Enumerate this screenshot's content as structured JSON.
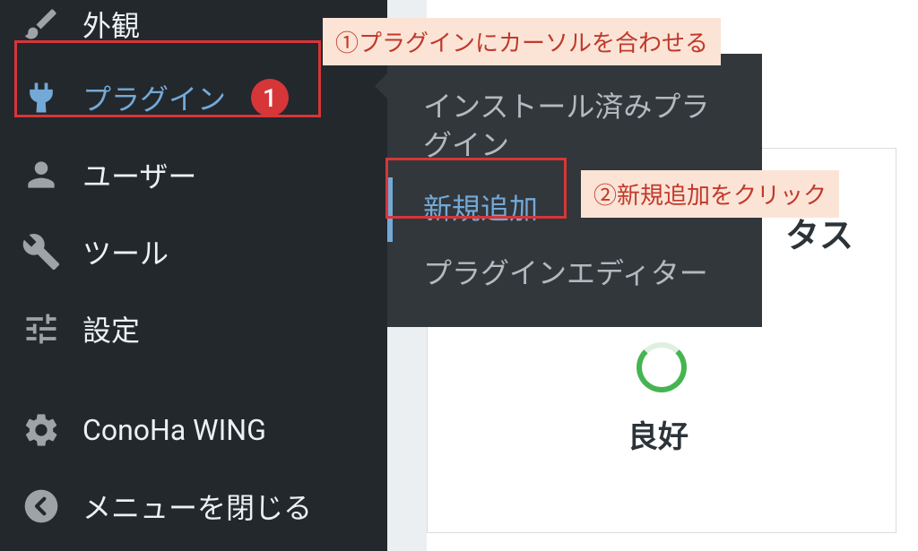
{
  "sidebar": {
    "items": [
      {
        "label": "外観"
      },
      {
        "label": "プラグイン",
        "badge": "1"
      },
      {
        "label": "ユーザー"
      },
      {
        "label": "ツール"
      },
      {
        "label": "設定"
      },
      {
        "label": "ConoHa WING"
      },
      {
        "label": "メニューを閉じる"
      }
    ]
  },
  "submenu": {
    "items": [
      {
        "label": "インストール済みプラグイン"
      },
      {
        "label": "新規追加"
      },
      {
        "label": "プラグインエディター"
      }
    ]
  },
  "annotations": {
    "step1": "①プラグインにカーソルを合わせる",
    "step2": "②新規追加をクリック"
  },
  "content": {
    "status_fragment": "タス",
    "status_word": "良好"
  }
}
